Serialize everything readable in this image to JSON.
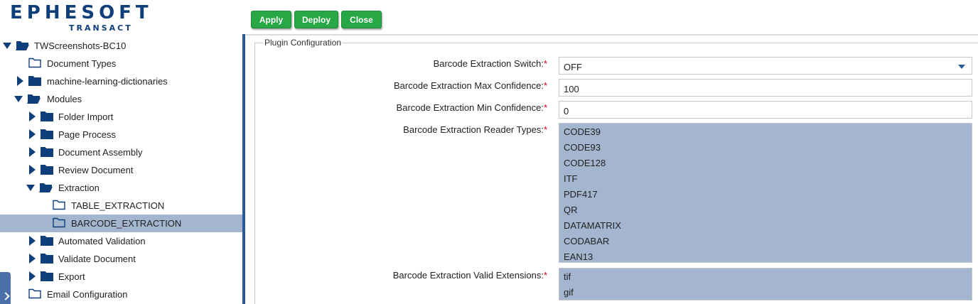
{
  "logo": {
    "main": "EPHESOFT",
    "sub": "TRANSACT"
  },
  "toolbar": {
    "apply_label": "Apply",
    "deploy_label": "Deploy",
    "close_label": "Close"
  },
  "tree": {
    "root": "TWScreenshots-BC10",
    "document_types": "Document Types",
    "ml_dictionaries": "machine-learning-dictionaries",
    "modules": "Modules",
    "folder_import": "Folder Import",
    "page_process": "Page Process",
    "document_assembly": "Document Assembly",
    "review_document": "Review Document",
    "extraction": "Extraction",
    "table_extraction": "TABLE_EXTRACTION",
    "barcode_extraction": "BARCODE_EXTRACTION",
    "automated_validation": "Automated Validation",
    "validate_document": "Validate Document",
    "export": "Export",
    "email_configuration": "Email Configuration"
  },
  "plugin": {
    "legend": "Plugin Configuration",
    "switch_label": "Barcode Extraction Switch:",
    "switch_value": "OFF",
    "max_conf_label": "Barcode Extraction Max Confidence:",
    "max_conf_value": "100",
    "min_conf_label": "Barcode Extraction Min Confidence:",
    "min_conf_value": "0",
    "reader_types_label": "Barcode Extraction Reader Types:",
    "reader_types": [
      "CODE39",
      "CODE93",
      "CODE128",
      "ITF",
      "PDF417",
      "QR",
      "DATAMATRIX",
      "CODABAR",
      "EAN13"
    ],
    "valid_ext_label": "Barcode Extraction Valid Extensions:",
    "valid_extensions": [
      "tif",
      "gif"
    ],
    "required_mark": "*"
  },
  "colors": {
    "button_green": "#28a745",
    "brand_navy": "#0f3f7a",
    "selection": "#a4b6cf",
    "required": "#d0021b"
  }
}
